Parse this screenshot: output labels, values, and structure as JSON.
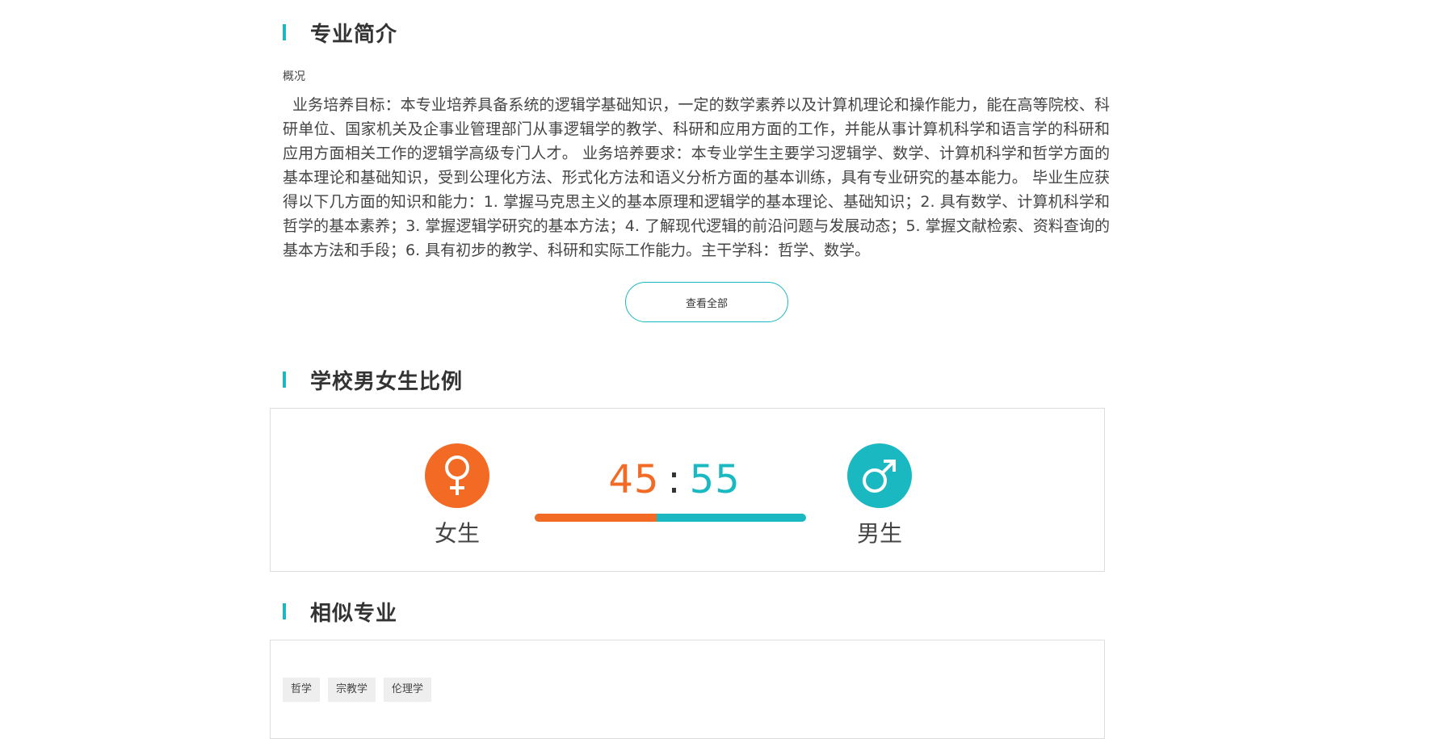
{
  "sections": {
    "intro_title": "专业简介",
    "ratio_title": "学校男女生比例",
    "similar_title": "相似专业"
  },
  "intro": {
    "subhead": "概况",
    "text": "业务培养目标：本专业培养具备系统的逻辑学基础知识，一定的数学素养以及计算机理论和操作能力，能在高等院校、科研单位、国家机关及企事业管理部门从事逻辑学的教学、科研和应用方面的工作，并能从事计算机科学和语言学的科研和应用方面相关工作的逻辑学高级专门人才。 业务培养要求：本专业学生主要学习逻辑学、数学、计算机科学和哲学方面的基本理论和基础知识，受到公理化方法、形式化方法和语义分析方面的基本训练，具有专业研究的基本能力。 毕业生应获得以下几方面的知识和能力：1. 掌握马克思主义的基本原理和逻辑学的基本理论、基础知识；2. 具有数学、计算机科学和哲学的基本素养；3. 掌握逻辑学研究的基本方法；4. 了解现代逻辑的前沿问题与发展动态；5. 掌握文献检索、资料查询的基本方法和手段；6. 具有初步的教学、科研和实际工作能力。主干学科：哲学、数学。",
    "view_all_label": "查看全部"
  },
  "ratio": {
    "female_label": "女生",
    "male_label": "男生",
    "female_value": "45",
    "separator": ":",
    "male_value": "55",
    "female_fraction": 0.45,
    "female_icon": "female-symbol-icon",
    "male_icon": "male-symbol-icon",
    "female_color": "#f26a24",
    "male_color": "#1ab8c0"
  },
  "similar": {
    "tags": [
      "哲学",
      "宗教学",
      "伦理学"
    ]
  },
  "colors": {
    "accent": "#1ab8c0",
    "female": "#f26a24"
  }
}
